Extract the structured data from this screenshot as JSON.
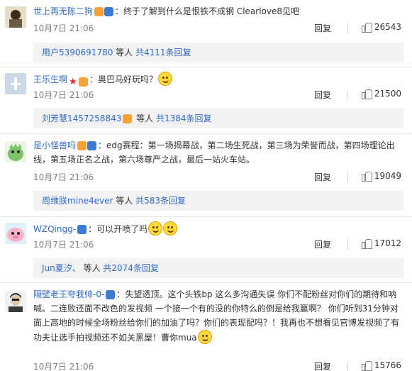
{
  "comments": [
    {
      "name": "世上再无陈二狗",
      "text": "终于了解到什么是恨铁不成钢 Clearlove8见吧",
      "time": "10月7日 21:06",
      "reply": "回复",
      "likes": "26543",
      "sub_user": "用户5390691780",
      "sub_mid": " 等人 ",
      "sub_more": "共4111条回复"
    },
    {
      "name": "王乐生啊",
      "text": "奥巴马好玩吗？",
      "time": "10月7日 21:06",
      "reply": "回复",
      "likes": "21500",
      "sub_user": "刘芳慧1457258843",
      "sub_mid": " 等人 ",
      "sub_more": "共1384条回复"
    },
    {
      "name": "是小怪兽吗",
      "text": "edg赛程：第一场揭幕战，第二场生死战，第三场为荣誉而战，第四场理论出线，第五场正名之战，第六场尊严之战，最后一站火车站。",
      "time": "10月7日 21:06",
      "reply": "回复",
      "likes": "19049",
      "sub_user": "周维朕mine4ever",
      "sub_mid": " 等人 ",
      "sub_more": "共583条回复"
    },
    {
      "name": "WZQingg-",
      "text": "可以开喷了吗",
      "time": "10月7日 21:06",
      "reply": "回复",
      "likes": "17012",
      "sub_user": "Jun夏汐、",
      "sub_mid": " 等人 ",
      "sub_more": "共2074条回复"
    },
    {
      "name": "隔壁老王夸我帅-0-",
      "text": "失望透顶。这个头铁bp 这么多沟通失误 你们不配粉丝对你们的期待和呐喊。二连败还面不改色的发视频 一个接一个有的没的你特么的倒是给我赢啊？ 你们听到31分钟对面上高地的时候全场粉丝给你们的加油了吗？你们的表现配吗？！我再也不想看见官博发视频了有功夫让选手拍视频还不如关黑屋！曹你mua",
      "time": "10月7日 21:06",
      "reply": "回复",
      "likes": "15766"
    }
  ],
  "colon": "："
}
